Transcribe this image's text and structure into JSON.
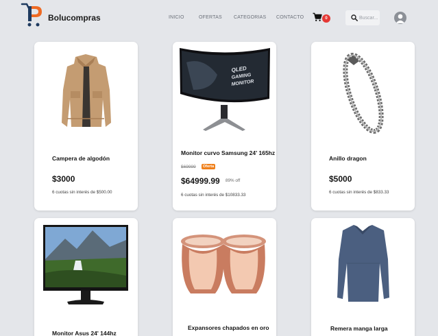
{
  "brand": {
    "name": "Bolucompras"
  },
  "nav": [
    {
      "label": "INICIO"
    },
    {
      "label": "OFERTAS"
    },
    {
      "label": "CATEGORIAS"
    },
    {
      "label": "CONTACTO"
    }
  ],
  "cart": {
    "count": "0"
  },
  "search": {
    "placeholder": "Buscar..."
  },
  "colors": {
    "background": "#e4e6ea",
    "badge": "#e53935",
    "offer": "#ef7f1a",
    "logo_blue": "#1e3a5f",
    "logo_orange": "#ef6a23"
  },
  "products": [
    {
      "name": "Campera de algodón",
      "price": "$3000",
      "installments": "6 cuotas sin interés de $500.00",
      "image": "jacket-image"
    },
    {
      "name": "Monitor curvo Samsung 24' 165hz",
      "old_price": "$69999",
      "offer_label": "Oferta",
      "price": "$64999.99",
      "discount": "89% off",
      "installments": "6 cuotas sin interés de $10833.33",
      "image": "curved-monitor-image"
    },
    {
      "name": "Anillo dragon",
      "price": "$5000",
      "installments": "6 cuotas sin interés de $833.33",
      "image": "bracelet-image"
    },
    {
      "name": "Monitor Asus 24' 144hz",
      "image": "monitor-image"
    },
    {
      "name": "Expansores chapados en oro",
      "image": "expanders-image"
    },
    {
      "name": "Remera manga larga",
      "image": "shirt-image"
    }
  ]
}
